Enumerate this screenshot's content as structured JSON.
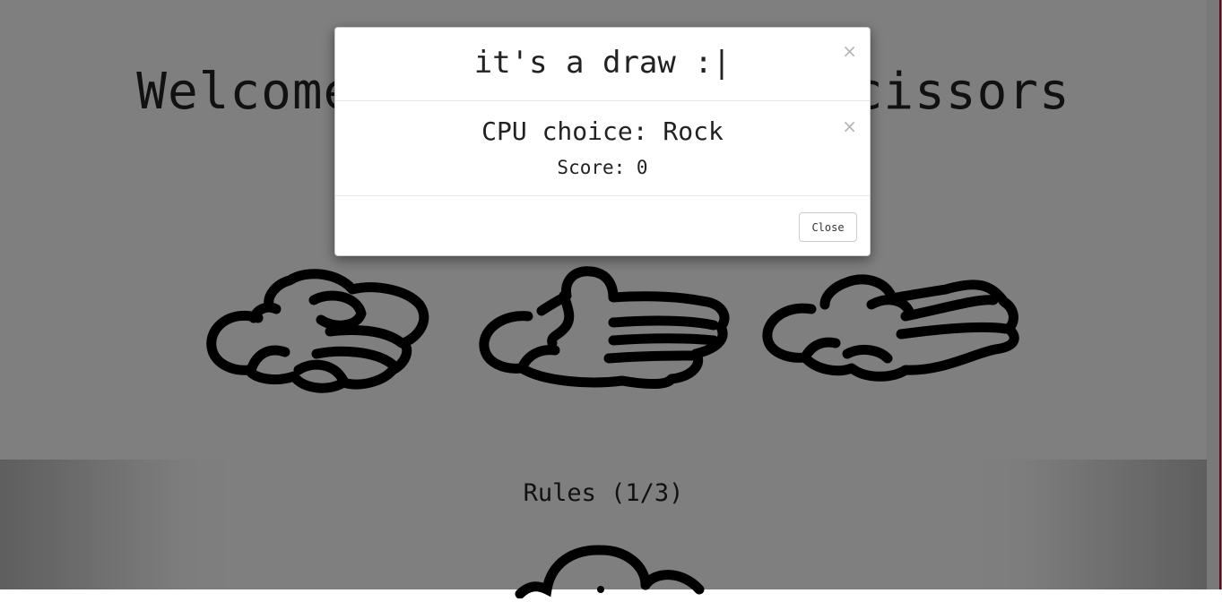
{
  "page": {
    "title": "Welcome to Rock Paper Scissors",
    "choices": [
      {
        "name": "Rock",
        "icon": "rock-hand-icon"
      },
      {
        "name": "Paper",
        "icon": "paper-hand-icon"
      },
      {
        "name": "Scissors",
        "icon": "scissors-hand-icon"
      }
    ],
    "rules_title": "Rules (1/3)"
  },
  "modal": {
    "title": "it's a draw :|",
    "header_close": "×",
    "body_close": "×",
    "cpu_choice": "CPU choice: Rock",
    "score": "Score: 0",
    "close_button": "Close"
  },
  "colors": {
    "overlay": "rgba(0,0,0,0.5)",
    "text": "#222222",
    "scrollbar_accent": "#c8102e"
  }
}
